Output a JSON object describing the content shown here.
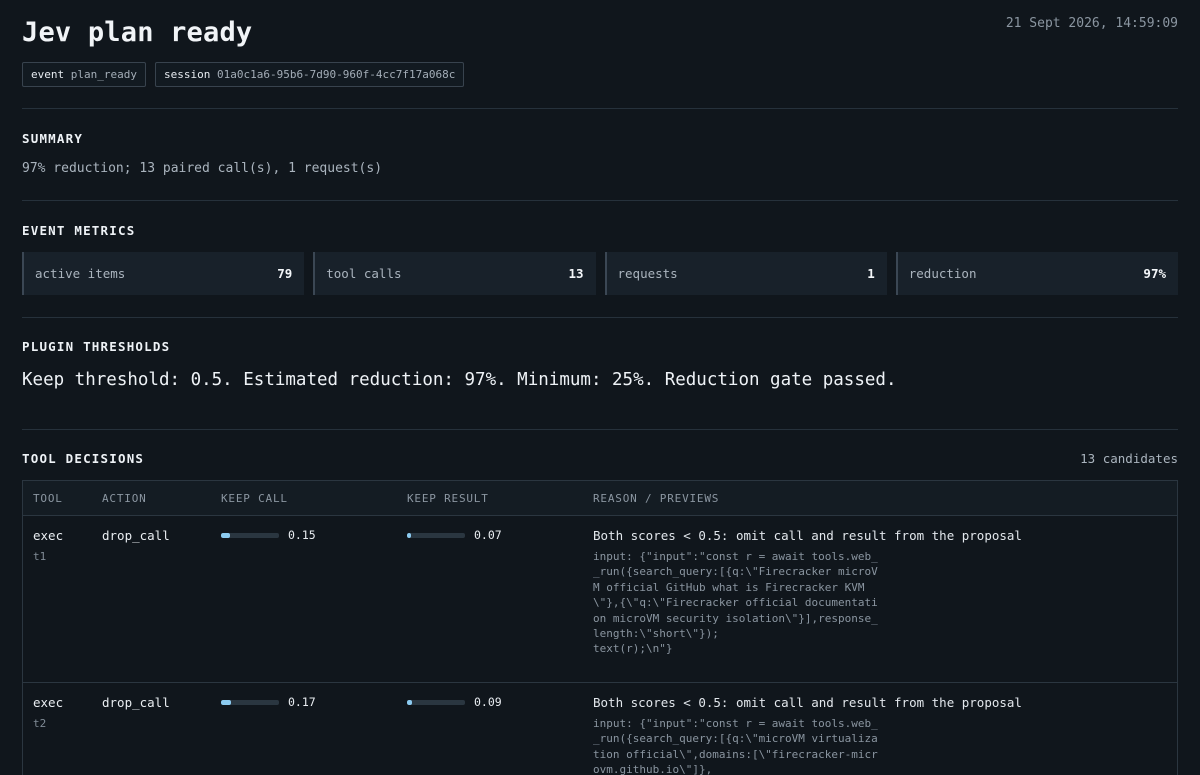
{
  "header": {
    "title": "Jev plan ready",
    "timestamp": "21 Sept 2026, 14:59:09",
    "chips": [
      {
        "key": "event",
        "value": "plan_ready"
      },
      {
        "key": "session",
        "value": "01a0c1a6-95b6-7d90-960f-4cc7f17a068c"
      }
    ]
  },
  "summary": {
    "title": "SUMMARY",
    "text": "97% reduction; 13 paired call(s), 1 request(s)"
  },
  "metrics": {
    "title": "EVENT METRICS",
    "items": [
      {
        "label": "active items",
        "value": "79"
      },
      {
        "label": "tool calls",
        "value": "13"
      },
      {
        "label": "requests",
        "value": "1"
      },
      {
        "label": "reduction",
        "value": "97%"
      }
    ]
  },
  "thresholds": {
    "title": "PLUGIN THRESHOLDS",
    "text": "Keep threshold: 0.5. Estimated reduction: 97%. Minimum: 25%. Reduction gate passed."
  },
  "decisions": {
    "title": "TOOL DECISIONS",
    "count": "13 candidates",
    "columns": [
      "TOOL",
      "ACTION",
      "KEEP CALL",
      "KEEP RESULT",
      "REASON / PREVIEWS"
    ],
    "rows": [
      {
        "tool": "exec",
        "id": "t1",
        "action": "drop_call",
        "keep_call": 0.15,
        "keep_call_label": "0.15",
        "keep_result": 0.07,
        "keep_result_label": "0.07",
        "reason": "Both scores < 0.5: omit call and result from the proposal",
        "preview": "input: {\"input\":\"const r = await tools.web__run({search_query:[{q:\\\"Firecracker microVM official GitHub what is Firecracker KVM\\\"},{\\\"q:\\\"Firecracker official documentation microVM security isolation\\\"}],response_length:\\\"short\\\"});\ntext(r);\\n\"}"
      },
      {
        "tool": "exec",
        "id": "t2",
        "action": "drop_call",
        "keep_call": 0.17,
        "keep_call_label": "0.17",
        "keep_result": 0.09,
        "keep_result_label": "0.09",
        "reason": "Both scores < 0.5: omit call and result from the proposal",
        "preview": "input: {\"input\":\"const r = await tools.web__run({search_query:[{q:\\\"microVM virtualization official\\\",domains:[\\\"firecracker-microvm.github.io\\\"]},"
      }
    ]
  },
  "colors": {
    "background": "#10161c",
    "accent_bar": "#8ccbf0"
  }
}
